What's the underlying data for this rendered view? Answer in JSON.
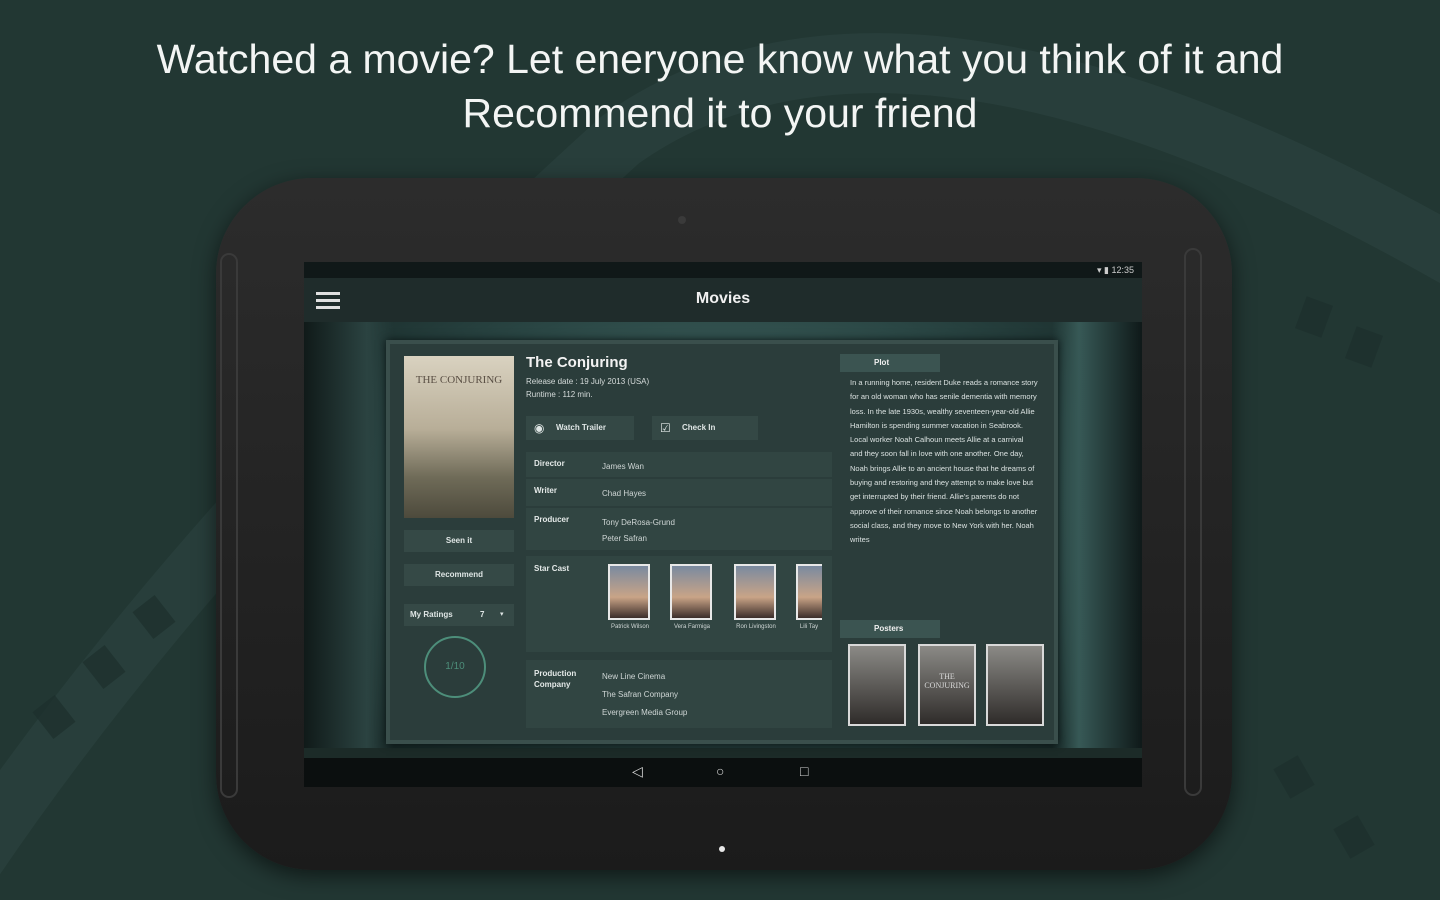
{
  "headline": {
    "line1": "Watched a movie? Let eneryone know what you think of it and",
    "line2": "Recommend it to your friend"
  },
  "device": {
    "status_time": "12:35"
  },
  "appbar": {
    "title": "Movies",
    "menu_icon": "hamburger-menu-icon"
  },
  "movie": {
    "poster_title": "THE CONJURING",
    "title": "The Conjuring",
    "release_date": "Release date : 19 July 2013 (USA)",
    "runtime": "Runtime : 112 min.",
    "buttons": {
      "watch_trailer": "Watch Trailer",
      "check_in": "Check In",
      "seen_it": "Seen it",
      "recommend": "Recommend"
    },
    "my_ratings": {
      "label": "My Ratings",
      "value": "7"
    },
    "seal_text": "1/10",
    "director": {
      "label": "Director",
      "value": "James Wan"
    },
    "writer": {
      "label": "Writer",
      "value": "Chad Hayes"
    },
    "producer": {
      "label": "Producer",
      "line1": "Tony DeRosa-Grund",
      "line2": "Peter Safran"
    },
    "star_cast": {
      "label": "Star Cast",
      "members": [
        {
          "name": "Patrick Wilson"
        },
        {
          "name": "Vera Farmiga"
        },
        {
          "name": "Ron Livingston"
        },
        {
          "name": "Lili Tay"
        }
      ]
    },
    "production_company": {
      "label": "Production Company",
      "lines": [
        "New Line Cinema",
        "The Safran Company",
        "Evergreen Media Group"
      ]
    },
    "plot": {
      "tab": "Plot",
      "text": "In a running home, resident Duke reads a romance story for an old woman who has senile dementia with memory loss. In the late 1930s, wealthy seventeen-year-old Allie Hamilton is spending summer vacation in Seabrook. Local worker Noah Calhoun meets Allie at a carnival and they soon fall in love with one another. One day, Noah brings Allie to an ancient house that he dreams of buying and restoring and they attempt to make love but get interrupted by their friend. Allie's parents do not approve of their romance since Noah belongs to another social class, and they move to New York with her. Noah writes"
    },
    "posters": {
      "tab": "Posters",
      "items": [
        "Poster 1",
        "THE CONJURING",
        "Poster 3"
      ]
    }
  },
  "navbar": {
    "back": "◁",
    "home": "○",
    "recents": "□"
  }
}
